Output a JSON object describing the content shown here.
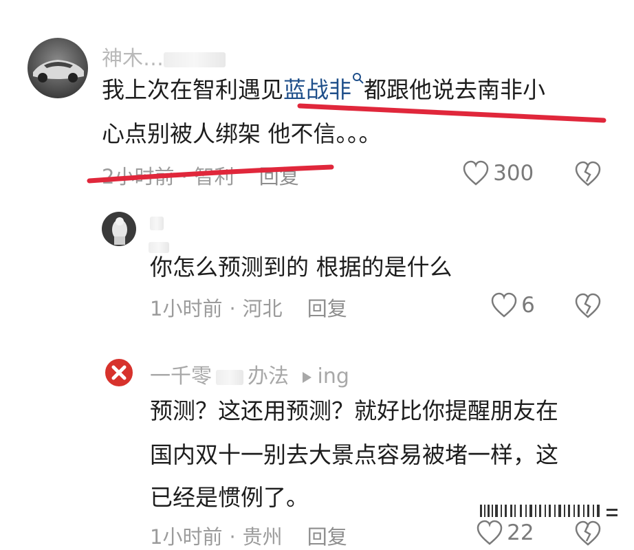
{
  "comments": [
    {
      "username": "神木…",
      "text_before": "我上次在智利遇见",
      "link": "蓝战非",
      "text_after": "都跟他说去南非小",
      "text_line2": "心点别被人绑架 他不信。。。",
      "time": "2小时前",
      "location": "智利",
      "reply_label": "回复",
      "likes": "300"
    },
    {
      "username": "",
      "text": "你怎么预测到的  根据的是什么",
      "time": "1小时前",
      "location": "河北",
      "reply_label": "回复",
      "likes": "6"
    },
    {
      "username": "一千零",
      "username_suffix": "办法",
      "reply_to": "ing",
      "text_line1": "预测？这还用预测？就好比你提醒朋友在",
      "text_line2": "国内双十一别去大景点容易被堵一样，这",
      "text_line3": "已经是惯例了。",
      "time": "1小时前",
      "location": "贵州",
      "reply_label": "回复",
      "likes": "22"
    }
  ],
  "colors": {
    "link": "#1f4f8a",
    "annotation_red": "#e0273b",
    "meta_gray": "#9b9b9b"
  },
  "icons": [
    "heart-outline-icon",
    "broken-heart-icon",
    "search-icon",
    "play-triangle-icon",
    "error-x-icon"
  ]
}
